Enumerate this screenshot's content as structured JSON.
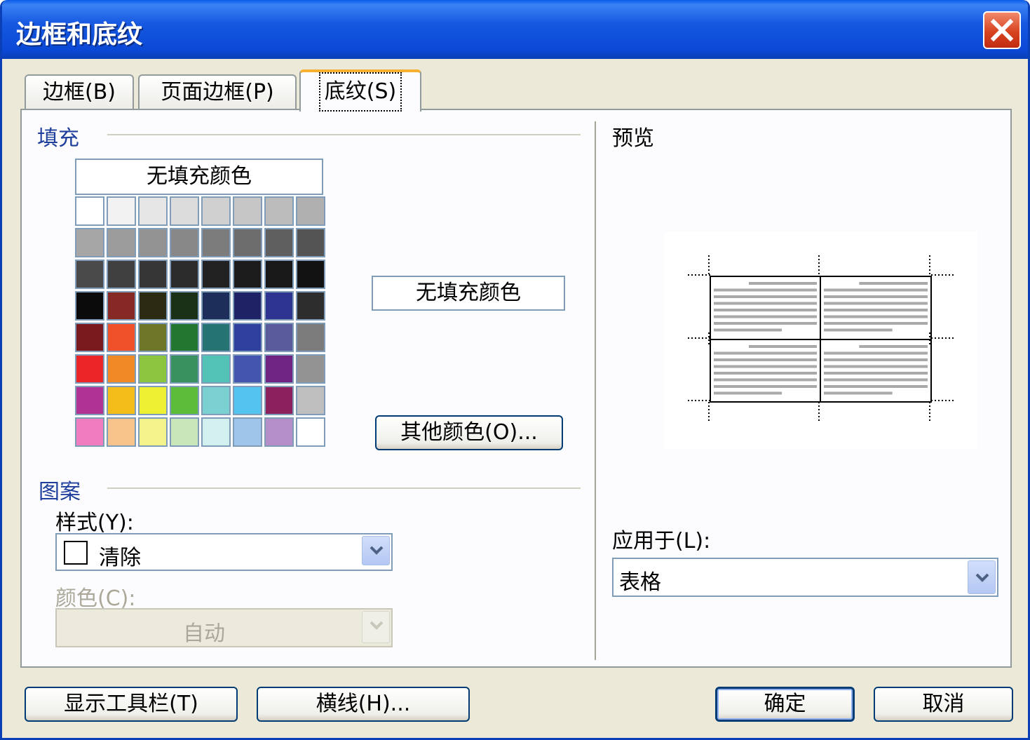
{
  "window": {
    "title": "边框和底纹"
  },
  "tabs": [
    {
      "label": "边框(B)"
    },
    {
      "label": "页面边框(P)"
    },
    {
      "label": "底纹(S)"
    }
  ],
  "fill": {
    "group_label": "填充",
    "no_fill_label": "无填充颜色",
    "selected_label": "无填充颜色",
    "more_colors_label": "其他颜色(O)...",
    "palette": [
      [
        "#ffffff",
        "#f2f2f2",
        "#e6e6e6",
        "#dcdcdc",
        "#d0d0d0",
        "#c6c6c6",
        "#bcbcbc",
        "#b0b0b0"
      ],
      [
        "#a6a6a6",
        "#9c9c9c",
        "#939393",
        "#888888",
        "#7c7c7c",
        "#6d6d6d",
        "#5f5f5f",
        "#545454"
      ],
      [
        "#4a4a4a",
        "#404040",
        "#363636",
        "#2c2c2c",
        "#222222",
        "#1c1c1c",
        "#181818",
        "#121212"
      ],
      [
        "#0b0b0b",
        "#862824",
        "#2b2b14",
        "#1a3118",
        "#1d2e5a",
        "#1f2366",
        "#2d3591",
        "#2d2d2d"
      ],
      [
        "#7a1a1f",
        "#f0512a",
        "#6d7629",
        "#23762f",
        "#267373",
        "#2f3f9e",
        "#595b9c",
        "#7b7b7b"
      ],
      [
        "#eb2428",
        "#f18a24",
        "#8cc63e",
        "#3a9160",
        "#52c2b6",
        "#4455b0",
        "#6f2382",
        "#939393"
      ],
      [
        "#b03293",
        "#f4bc18",
        "#eef033",
        "#5cbd3a",
        "#7bd0d2",
        "#55c3ef",
        "#8c205c",
        "#bfbfbf"
      ],
      [
        "#f07dc0",
        "#f8c28b",
        "#f4f28a",
        "#c8e6b7",
        "#d4eff0",
        "#9fc5ea",
        "#b48fc8",
        "#ffffff"
      ]
    ]
  },
  "pattern": {
    "group_label": "图案",
    "style_label": "样式(Y):",
    "style_value": "清除",
    "color_label": "颜色(C):",
    "color_value": "自动"
  },
  "preview": {
    "label": "预览"
  },
  "apply": {
    "label": "应用于(L):",
    "value": "表格"
  },
  "buttons": {
    "show_toolbar": "显示工具栏(T)",
    "horizontal_line": "横线(H)...",
    "ok": "确定",
    "cancel": "取消"
  }
}
